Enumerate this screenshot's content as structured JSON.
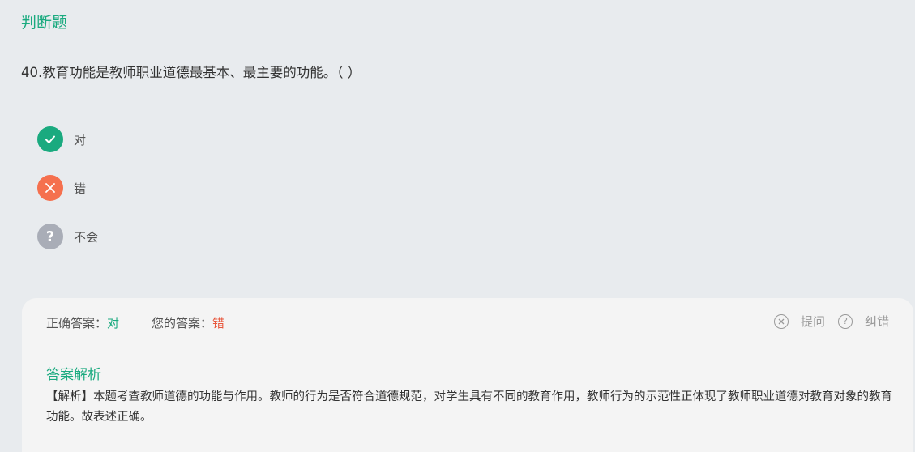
{
  "section": {
    "title": "判断题"
  },
  "question": {
    "text": "40.教育功能是教师职业道德最基本、最主要的功能。（   ）"
  },
  "options": [
    {
      "label": "对",
      "icon": "check-icon",
      "color": "#1aaa7f"
    },
    {
      "label": "错",
      "icon": "close-icon",
      "color": "#f5704e"
    },
    {
      "label": "不会",
      "icon": "question-icon",
      "color": "#a9adb7"
    }
  ],
  "result": {
    "correct_label": "正确答案：",
    "correct_value": "对",
    "yours_label": "您的答案：",
    "yours_value": "错"
  },
  "tools": {
    "ask_label": "提问",
    "ask_icon": "circle-x-icon",
    "report_label": "纠错",
    "report_icon": "help-circle-icon"
  },
  "analysis": {
    "title": "答案解析",
    "body": "【解析】本题考查教师道德的功能与作用。教师的行为是否符合道德规范，对学生具有不同的教育作用，教师行为的示范性正体现了教师职业道德对教育对象的教育功能。故表述正确。"
  }
}
